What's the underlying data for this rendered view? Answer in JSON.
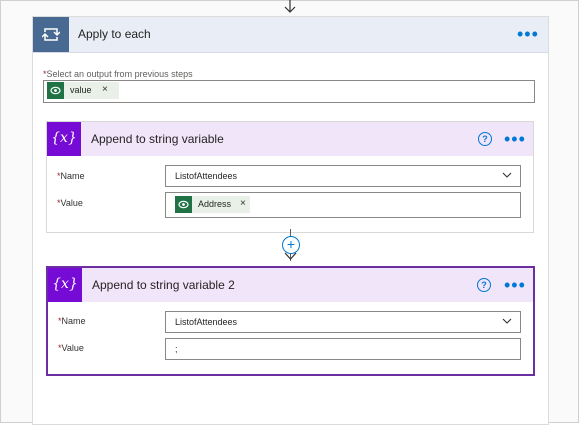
{
  "loop": {
    "title": "Apply to each",
    "more": "•••",
    "select_label_required": "*",
    "select_label": "Select an output from previous steps",
    "token": "value",
    "token_remove": "×"
  },
  "action1": {
    "title": "Append to string variable",
    "help": "?",
    "more": "•••",
    "icon_text": "{x}",
    "name_label": "Name",
    "name_value": "ListofAttendees",
    "value_label": "Value",
    "value_token": "Address",
    "value_token_remove": "×"
  },
  "action2": {
    "title": "Append to string variable 2",
    "help": "?",
    "more": "•••",
    "icon_text": "{x}",
    "name_label": "Name",
    "name_value": "ListofAttendees",
    "value_label": "Value",
    "value_text": ";"
  },
  "required_mark": "*",
  "add_step_glyph": "+",
  "colors": {
    "loop_header": "#e9eef6",
    "loop_icon": "#486991",
    "action_header": "#f1e5fa",
    "variable_icon": "#770bd6",
    "selected_border": "#6b2fa0",
    "token_icon": "#217346",
    "accent": "#0078d4"
  }
}
